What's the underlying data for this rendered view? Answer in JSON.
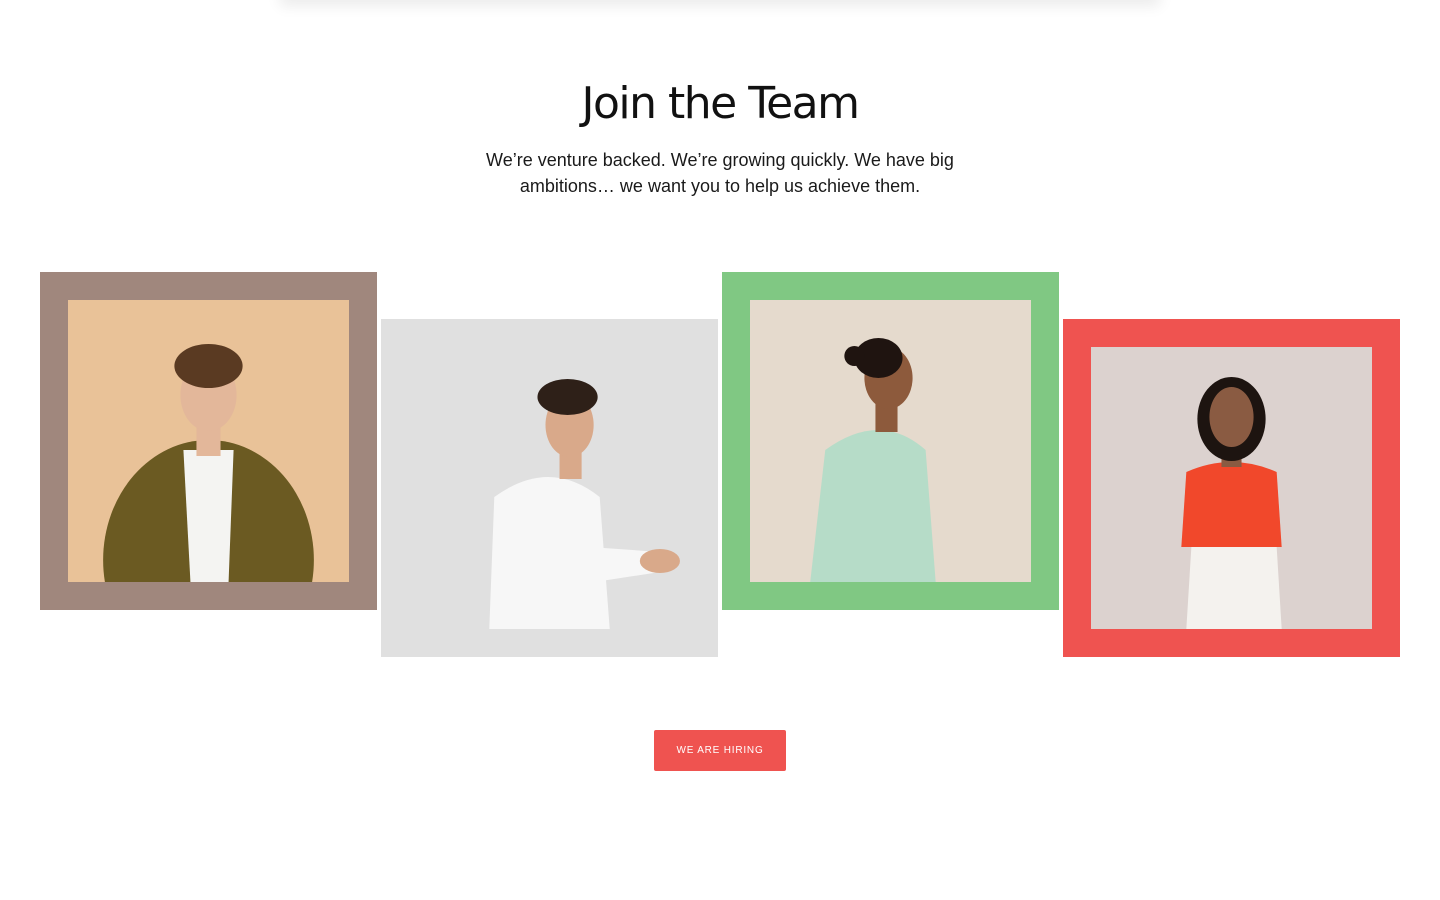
{
  "header": {
    "title": "Join the Team",
    "subtitle": "We’re venture backed. We’re growing quickly. We have big ambitions… we want you to help us achieve them."
  },
  "team_cards": [
    {
      "frame_color": "#a0877d",
      "photo_bg": "#e9c298",
      "shirt": "#6b5a22",
      "inner": "#f4f4f2",
      "skin": "#e3b79a",
      "hair": "#5a3a22",
      "icon": "man-portrait-image"
    },
    {
      "frame_color": "#e0e0e0",
      "photo_bg": "#e0e0e0",
      "shirt": "#f7f7f7",
      "inner": "#f7f7f7",
      "skin": "#d9a98a",
      "hair": "#2e2018",
      "icon": "man-portrait-image"
    },
    {
      "frame_color": "#80c883",
      "photo_bg": "#e5dacd",
      "shirt": "#b6dcc8",
      "inner": "#b6dcc8",
      "skin": "#8d5a3c",
      "hair": "#1f1410",
      "icon": "woman-portrait-image"
    },
    {
      "frame_color": "#ef5350",
      "photo_bg": "#dcd2cf",
      "shirt": "#f1482b",
      "inner": "#f4f2ee",
      "skin": "#8a5b42",
      "hair": "#1d1410",
      "icon": "woman-portrait-image"
    }
  ],
  "cta": {
    "label": "WE ARE HIRING",
    "color": "#ef5350"
  }
}
